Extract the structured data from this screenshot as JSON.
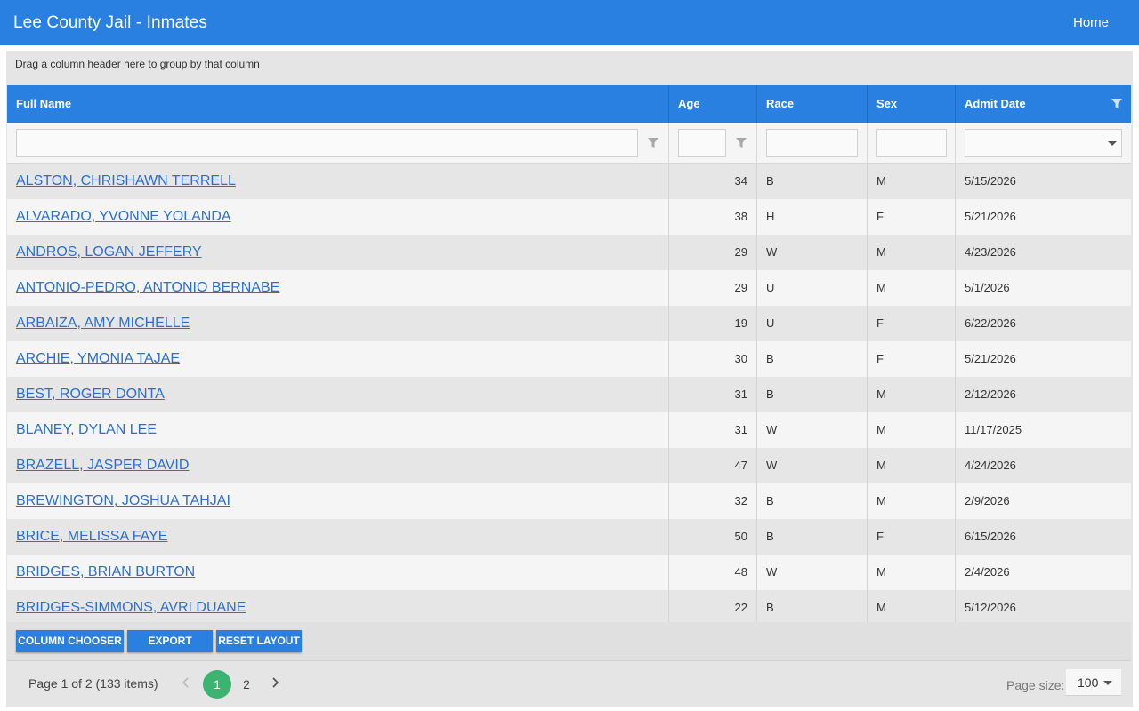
{
  "app": {
    "title": "Lee County Jail - Inmates",
    "nav_home": "Home"
  },
  "grid": {
    "group_panel_text": "Drag a column header here to group by that column",
    "columns": [
      "Full Name",
      "Age",
      "Race",
      "Sex",
      "Admit Date"
    ],
    "rows": [
      {
        "name": "ALSTON, CHRISHAWN TERRELL",
        "age": "34",
        "race": "B",
        "sex": "M",
        "admit": "5/15/2026"
      },
      {
        "name": "ALVARADO, YVONNE YOLANDA",
        "age": "38",
        "race": "H",
        "sex": "F",
        "admit": "5/21/2026"
      },
      {
        "name": "ANDROS, LOGAN JEFFERY",
        "age": "29",
        "race": "W",
        "sex": "M",
        "admit": "4/23/2026"
      },
      {
        "name": "ANTONIO-PEDRO, ANTONIO BERNABE",
        "age": "29",
        "race": "U",
        "sex": "M",
        "admit": "5/1/2026"
      },
      {
        "name": "ARBAIZA, AMY MICHELLE",
        "age": "19",
        "race": "U",
        "sex": "F",
        "admit": "6/22/2026"
      },
      {
        "name": "ARCHIE, YMONIA TAJAE",
        "age": "30",
        "race": "B",
        "sex": "F",
        "admit": "5/21/2026"
      },
      {
        "name": "BEST, ROGER DONTA",
        "age": "31",
        "race": "B",
        "sex": "M",
        "admit": "2/12/2026"
      },
      {
        "name": "BLANEY, DYLAN LEE",
        "age": "31",
        "race": "W",
        "sex": "M",
        "admit": "11/17/2025"
      },
      {
        "name": "BRAZELL, JASPER DAVID",
        "age": "47",
        "race": "W",
        "sex": "M",
        "admit": "4/24/2026"
      },
      {
        "name": "BREWINGTON, JOSHUA TAHJAI",
        "age": "32",
        "race": "B",
        "sex": "M",
        "admit": "2/9/2026"
      },
      {
        "name": "BRICE, MELISSA FAYE",
        "age": "50",
        "race": "B",
        "sex": "F",
        "admit": "6/15/2026"
      },
      {
        "name": "BRIDGES, BRIAN BURTON",
        "age": "48",
        "race": "W",
        "sex": "M",
        "admit": "2/4/2026"
      },
      {
        "name": "BRIDGES-SIMMONS, AVRI DUANE",
        "age": "22",
        "race": "B",
        "sex": "M",
        "admit": "5/12/2026"
      }
    ]
  },
  "toolbar": {
    "column_chooser": "COLUMN CHOOSER",
    "export": "EXPORT",
    "reset_layout": "RESET LAYOUT"
  },
  "pager": {
    "info": "Page 1 of 2 (133 items)",
    "pages": [
      "1",
      "2"
    ],
    "current_page": "1",
    "page_size_label": "Page size:",
    "page_size": "100"
  },
  "colors": {
    "header_blue": "#2a80e0",
    "active_page": "#3cb371",
    "link": "#2a6fd6"
  }
}
